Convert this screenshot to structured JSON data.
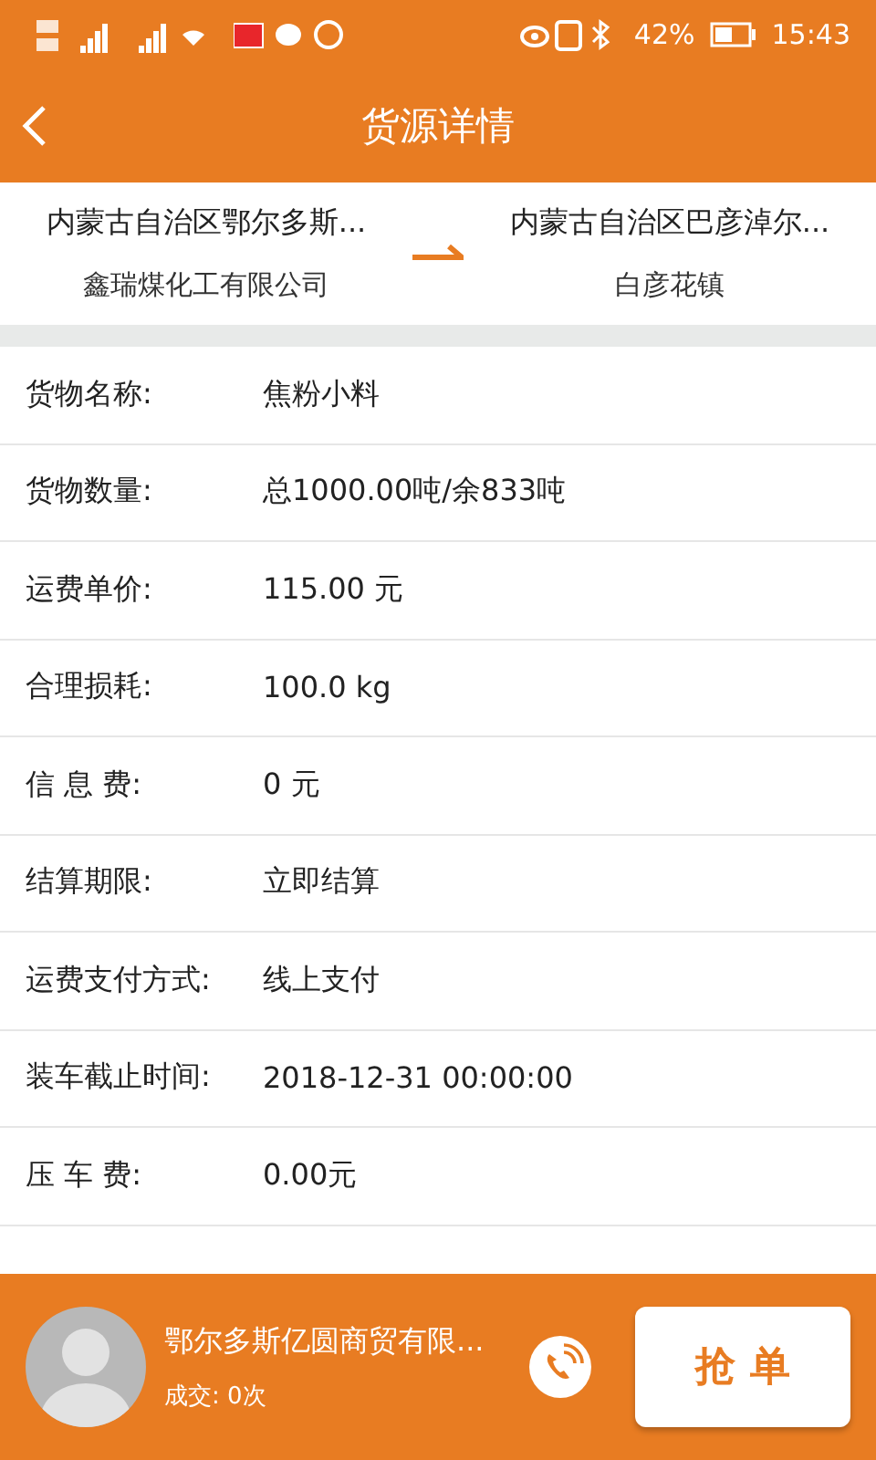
{
  "status_bar": {
    "battery": "42%",
    "time": "15:43"
  },
  "header": {
    "title": "货源详情"
  },
  "route": {
    "origin": {
      "region": "内蒙古自治区鄂尔多斯...",
      "place": "鑫瑞煤化工有限公司"
    },
    "destination": {
      "region": "内蒙古自治区巴彦淖尔...",
      "place": "白彦花镇"
    }
  },
  "details": [
    {
      "label": "货物名称:",
      "value": "焦粉小料"
    },
    {
      "label": "货物数量:",
      "value": "总1000.00吨/余833吨"
    },
    {
      "label": "运费单价:",
      "value": "115.00 元"
    },
    {
      "label": "合理损耗:",
      "value": "100.0 kg"
    },
    {
      "label": "信 息 费:",
      "value": "0 元"
    },
    {
      "label": "结算期限:",
      "value": "立即结算"
    },
    {
      "label": "运费支付方式:",
      "value": "线上支付"
    },
    {
      "label": "装车截止时间:",
      "value": "2018-12-31 00:00:00"
    },
    {
      "label": "压 车 费:",
      "value": "0.00元"
    }
  ],
  "footer": {
    "company": "鄂尔多斯亿圆商贸有限...",
    "deals": "成交: 0次",
    "action": "抢 单"
  }
}
